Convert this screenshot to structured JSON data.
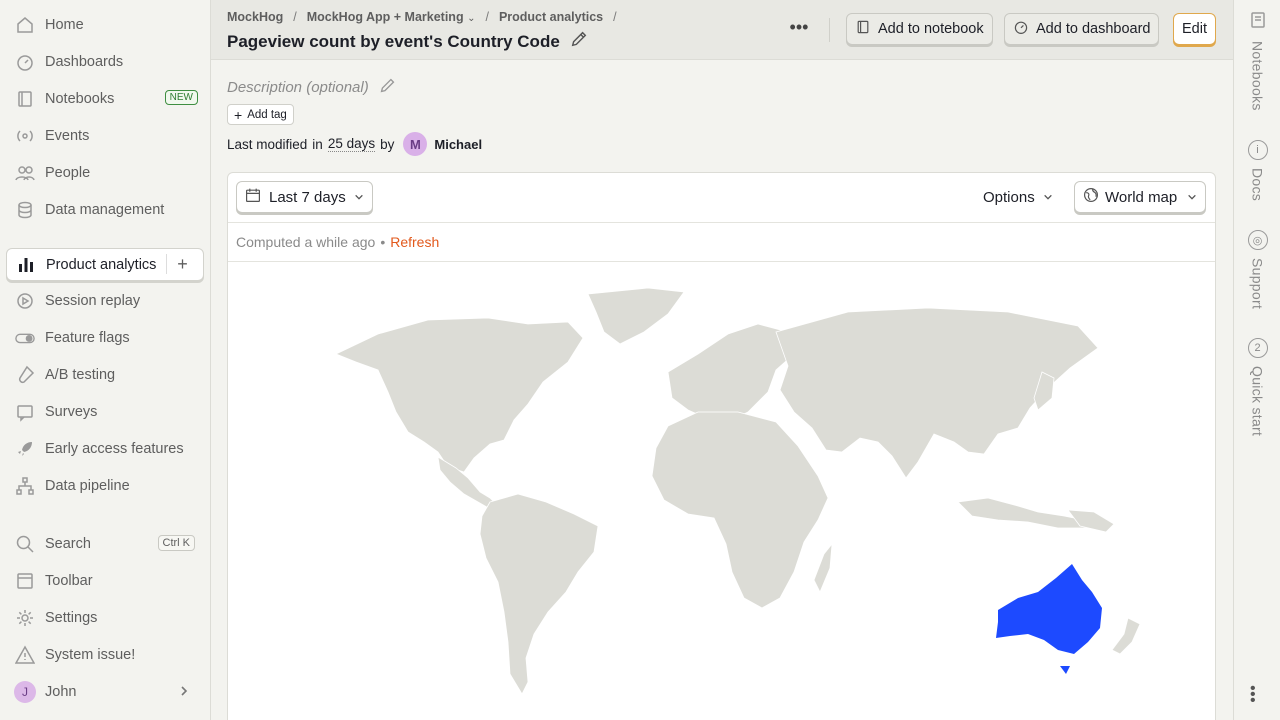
{
  "sidebar": {
    "items": [
      {
        "label": "Home",
        "icon": "home-icon"
      },
      {
        "label": "Dashboards",
        "icon": "dashboard-icon"
      },
      {
        "label": "Notebooks",
        "icon": "notebook-icon",
        "badge": "NEW"
      },
      {
        "label": "Events",
        "icon": "events-icon"
      },
      {
        "label": "People",
        "icon": "people-icon"
      },
      {
        "label": "Data management",
        "icon": "database-icon"
      },
      {
        "label": "Product analytics",
        "icon": "bar-chart-icon"
      },
      {
        "label": "Session replay",
        "icon": "replay-icon"
      },
      {
        "label": "Feature flags",
        "icon": "toggle-icon"
      },
      {
        "label": "A/B testing",
        "icon": "flask-icon"
      },
      {
        "label": "Surveys",
        "icon": "survey-icon"
      },
      {
        "label": "Early access features",
        "icon": "rocket-icon"
      },
      {
        "label": "Data pipeline",
        "icon": "pipeline-icon"
      },
      {
        "label": "Search",
        "icon": "search-icon",
        "shortcut": "Ctrl K"
      },
      {
        "label": "Toolbar",
        "icon": "toolbar-icon"
      },
      {
        "label": "Settings",
        "icon": "gear-icon"
      },
      {
        "label": "System issue!",
        "icon": "warning-icon"
      },
      {
        "label": "John",
        "icon": "avatar",
        "avatar_letter": "J"
      }
    ]
  },
  "header": {
    "breadcrumbs": [
      "MockHog",
      "MockHog App + Marketing",
      "Product analytics"
    ],
    "title": "Pageview count by event's Country Code",
    "add_to_notebook": "Add to notebook",
    "add_to_dashboard": "Add to dashboard",
    "edit": "Edit"
  },
  "rail": {
    "items": [
      {
        "label": "Notebooks",
        "icon": "notebook-icon"
      },
      {
        "label": "Docs",
        "icon": "info-icon"
      },
      {
        "label": "Support",
        "icon": "support-icon"
      },
      {
        "label": "Quick start",
        "icon": "quickstart-icon",
        "count": "2"
      }
    ]
  },
  "insight": {
    "description_placeholder": "Description (optional)",
    "add_tag": "Add tag",
    "last_modified_prefix": "Last modified",
    "last_modified_in": "in",
    "last_modified_time": "25 days",
    "last_modified_by": "by",
    "author_initial": "M",
    "author": "Michael",
    "date_range": "Last 7 days",
    "options": "Options",
    "visualization": "World map",
    "computed": "Computed a while ago",
    "bullet": "•",
    "refresh": "Refresh"
  },
  "map": {
    "highlighted_country": "Australia",
    "highlight_color": "#1d4aff",
    "land_color": "#dcdcd6",
    "water_color": "#ffffff"
  },
  "colors": {
    "accent": "#e2591c",
    "edit_border": "#e0a84c"
  }
}
